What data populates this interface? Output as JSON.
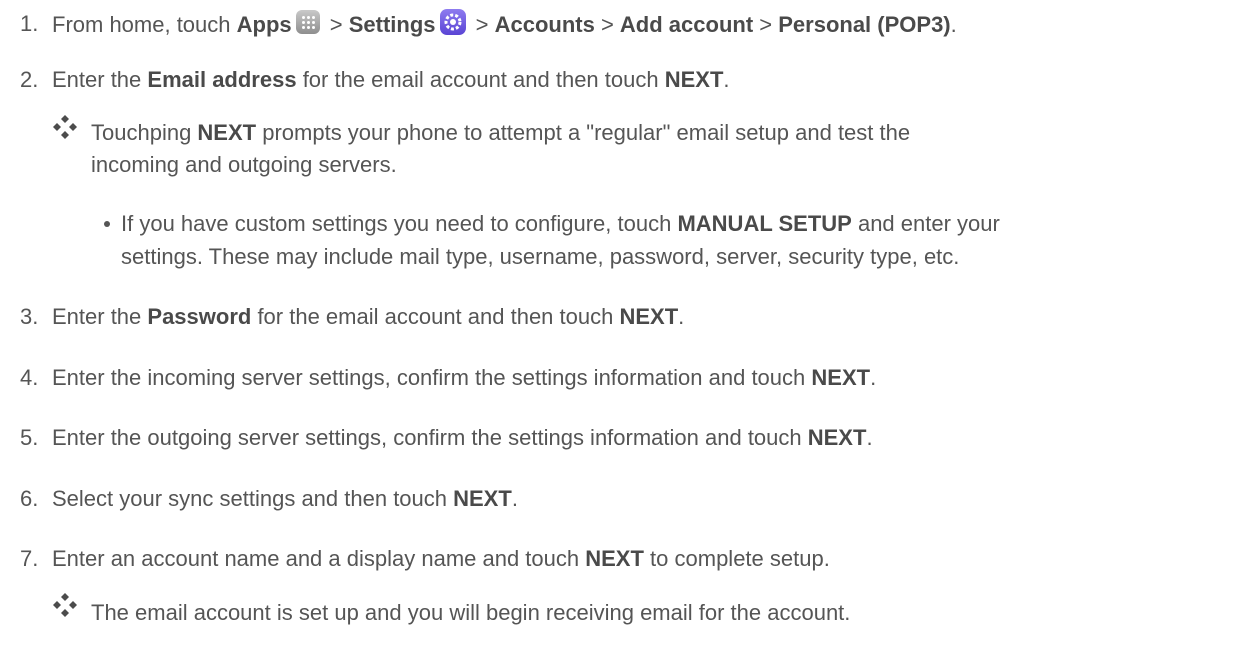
{
  "steps": [
    {
      "number": "1.",
      "t1": "From home, touch ",
      "b1": "Apps",
      "apps_icon": "apps-grid-icon",
      "t2": " > ",
      "b2": "Settings",
      "settings_icon": "gear-icon",
      "t3": " > ",
      "b3": "Accounts",
      "t4": " > ",
      "b4": "Add account",
      "t5": " > ",
      "b5": "Personal (POP3)",
      "t6": "."
    },
    {
      "number": "2.",
      "t1": "Enter the ",
      "b1": "Email address",
      "t2": " for the email account and then touch ",
      "b2": "NEXT",
      "t3": "."
    },
    {
      "number": "3.",
      "t1": "Enter the ",
      "b1": "Password",
      "t2": " for the email account and then touch ",
      "b2": "NEXT",
      "t3": "."
    },
    {
      "number": "4.",
      "t1": "Enter the incoming server settings, confirm the settings information and touch ",
      "b1": "NEXT",
      "t2": "."
    },
    {
      "number": "5.",
      "t1": "Enter the outgoing server settings, confirm the settings information and touch ",
      "b1": "NEXT",
      "t2": "."
    },
    {
      "number": "6.",
      "t1": "Select your sync settings and then touch ",
      "b1": "NEXT",
      "t2": "."
    },
    {
      "number": "7.",
      "t1": "Enter an account name and a display name and touch ",
      "b1": "NEXT",
      "t2": " to complete setup."
    }
  ],
  "note_next": {
    "t1": "Touchping ",
    "b1": "NEXT",
    "t2": " prompts your phone to attempt a \"regular\" email setup and test the",
    "line2": "incoming and outgoing servers."
  },
  "bullet_manual": {
    "t1": "If you have custom settings you need to configure, touch ",
    "b1": "MANUAL SETUP",
    "t2": " and enter your",
    "line2": "settings. These may include mail type, username, password, server, security type, etc."
  },
  "note_done": {
    "t1": "The email account is set up and you will begin receiving email for the account."
  },
  "colors": {
    "text": "#555555",
    "bold": "#4a4a4a",
    "diamond": "#4c4c4c",
    "settings_icon": "#6a52e0"
  }
}
